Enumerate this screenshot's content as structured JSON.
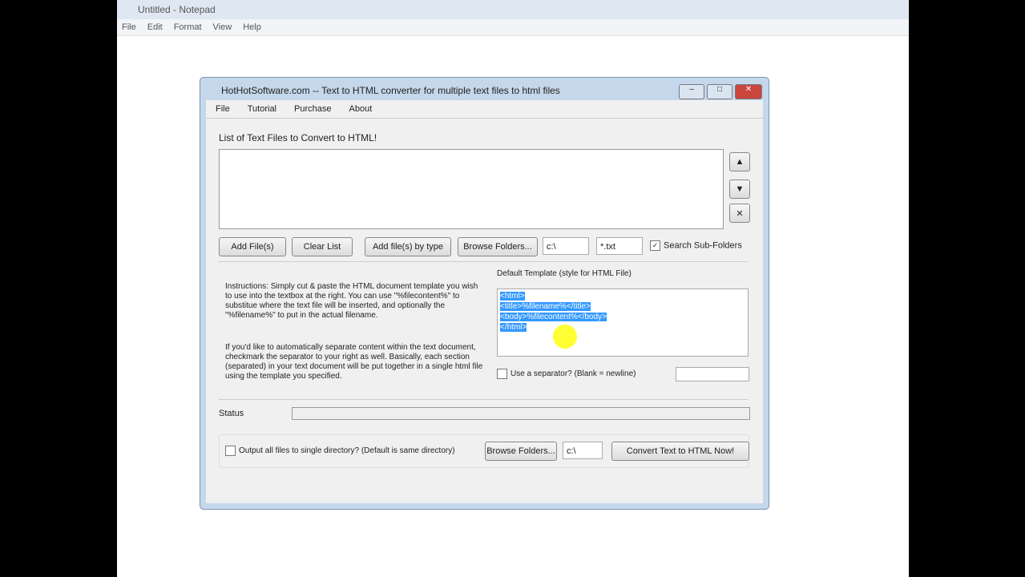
{
  "notepad": {
    "title": "Untitled - Notepad",
    "menu": [
      "File",
      "Edit",
      "Format",
      "View",
      "Help"
    ]
  },
  "app": {
    "title": "HotHotSoftware.com -- Text to HTML converter for multiple text files to html files",
    "menu": [
      "File",
      "Tutorial",
      "Purchase",
      "About"
    ],
    "list_label": "List of Text Files to Convert to HTML!",
    "up": "▲",
    "down": "▼",
    "remove": "✕",
    "buttons": {
      "add_files": "Add File(s)",
      "clear": "Clear List",
      "add_by_type": "Add file(s) by type",
      "browse": "Browse Folders...",
      "browse2": "Browse Folders...",
      "convert": "Convert Text to HTML Now!"
    },
    "path": "c:\\",
    "ext": "*.txt",
    "subfolders": "Search Sub-Folders",
    "instructions1": "Instructions: Simply cut & paste the HTML document template you wish to use into the textbox at the right. You can use \"%filecontent%\" to substitue where the text file will be inserted, and optionally the \"%filename%\" to put in the actual filename.",
    "instructions2": "If you'd like to automatically separate content within the text document, checkmark the separator to your right as well. Basically, each section (separated) in your text document will be put together in a single html file using the template you specified.",
    "template_label": "Default Template (style for HTML File)",
    "template": [
      "<html>",
      "<title>%filename%</title>",
      "<body>%filecontent%</body>",
      "</html>"
    ],
    "separator": "Use a separator? (Blank = newline)",
    "status": "Status",
    "progress": 0,
    "output_dir": "Output all files to single directory? (Default is same directory)",
    "out_path": "c:\\"
  }
}
